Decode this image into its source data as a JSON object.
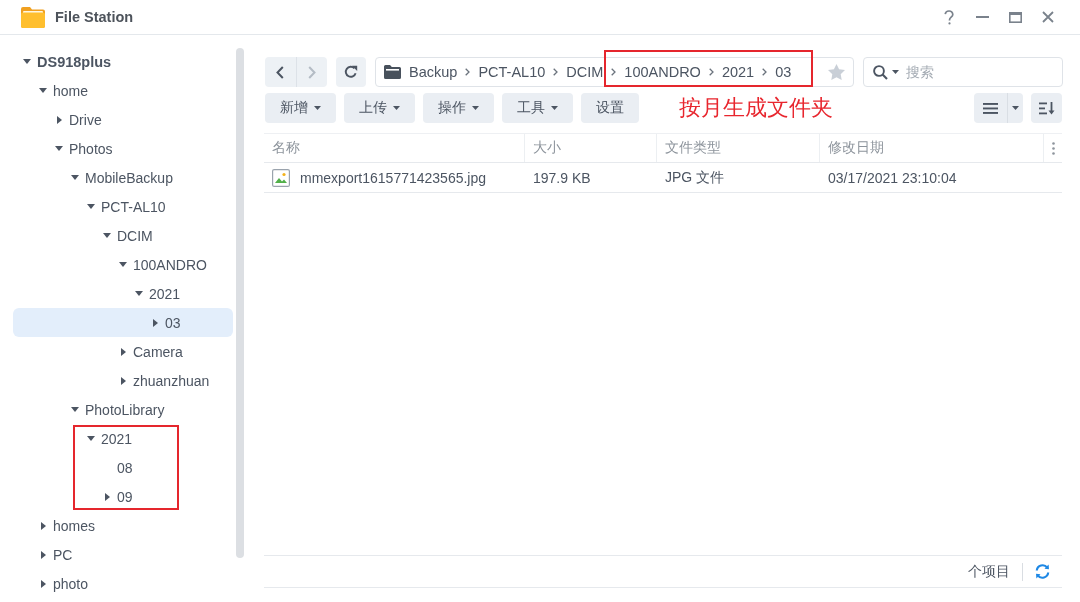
{
  "window": {
    "title": "File Station"
  },
  "tree": [
    {
      "label": "DS918plus",
      "expandable": true,
      "expanded": true,
      "selected": false,
      "children": [
        {
          "label": "home",
          "expandable": true,
          "expanded": true,
          "selected": false,
          "children": [
            {
              "label": "Drive",
              "expandable": true,
              "expanded": false,
              "selected": false
            },
            {
              "label": "Photos",
              "expandable": true,
              "expanded": true,
              "selected": false,
              "children": [
                {
                  "label": "MobileBackup",
                  "expandable": true,
                  "expanded": true,
                  "selected": false,
                  "children": [
                    {
                      "label": "PCT-AL10",
                      "expandable": true,
                      "expanded": true,
                      "selected": false,
                      "children": [
                        {
                          "label": "DCIM",
                          "expandable": true,
                          "expanded": true,
                          "selected": false,
                          "children": [
                            {
                              "label": "100ANDRO",
                              "expandable": true,
                              "expanded": true,
                              "selected": false,
                              "children": [
                                {
                                  "label": "2021",
                                  "expandable": true,
                                  "expanded": true,
                                  "selected": false,
                                  "children": [
                                    {
                                      "label": "03",
                                      "expandable": true,
                                      "expanded": false,
                                      "selected": true
                                    }
                                  ]
                                }
                              ]
                            },
                            {
                              "label": "Camera",
                              "expandable": true,
                              "expanded": false,
                              "selected": false
                            },
                            {
                              "label": "zhuanzhuan",
                              "expandable": true,
                              "expanded": false,
                              "selected": false
                            }
                          ]
                        }
                      ]
                    }
                  ]
                },
                {
                  "label": "PhotoLibrary",
                  "expandable": true,
                  "expanded": true,
                  "selected": false,
                  "children": [
                    {
                      "label": "2021",
                      "expandable": true,
                      "expanded": true,
                      "selected": false,
                      "children": [
                        {
                          "label": "08",
                          "expandable": false,
                          "expanded": false,
                          "selected": false
                        },
                        {
                          "label": "09",
                          "expandable": true,
                          "expanded": false,
                          "selected": false
                        }
                      ]
                    }
                  ]
                }
              ]
            }
          ]
        },
        {
          "label": "homes",
          "expandable": true,
          "expanded": false,
          "selected": false
        },
        {
          "label": "PC",
          "expandable": true,
          "expanded": false,
          "selected": false
        },
        {
          "label": "photo",
          "expandable": true,
          "expanded": false,
          "selected": false
        }
      ]
    }
  ],
  "toolbar": {
    "back": {
      "disabled": false
    },
    "forward": {
      "disabled": true
    },
    "path": [
      "Backup",
      "PCT-AL10",
      "DCIM",
      "100ANDRO",
      "2021",
      "03"
    ],
    "starred": false,
    "search": {
      "placeholder": "搜索"
    }
  },
  "actions": [
    {
      "label": "新增",
      "dropdown": true
    },
    {
      "label": "上传",
      "dropdown": true
    },
    {
      "label": "操作",
      "dropdown": true
    },
    {
      "label": "工具",
      "dropdown": true
    },
    {
      "label": "设置",
      "dropdown": false
    }
  ],
  "annotation": "按月生成文件夹",
  "table": {
    "columns": [
      "名称",
      "大小",
      "文件类型",
      "修改日期"
    ],
    "rows": [
      {
        "selected": false,
        "cells": [
          "mmexport1615771423565.jpg",
          "197.9 KB",
          "JPG 文件",
          "03/17/2021 23:10:04"
        ]
      }
    ]
  },
  "status_bar": {
    "count": "个项目"
  }
}
